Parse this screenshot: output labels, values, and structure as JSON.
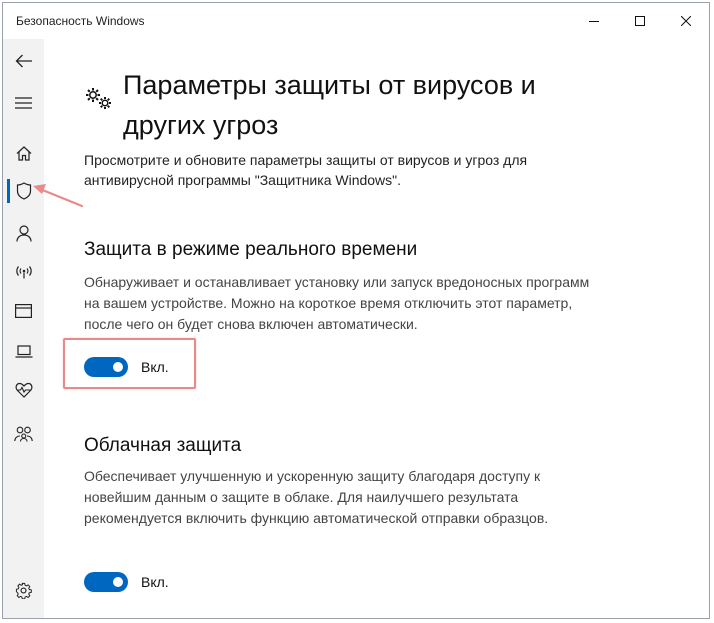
{
  "window": {
    "title": "Безопасность Windows"
  },
  "colors": {
    "accent": "#0067c0",
    "sidebar_bg": "#f2f2f2",
    "annotation": "#e8898a"
  },
  "sidebar": {
    "items": [
      {
        "icon": "back-arrow-icon"
      },
      {
        "icon": "hamburger-menu-icon"
      },
      {
        "icon": "home-icon"
      },
      {
        "icon": "shield-icon",
        "active": true
      },
      {
        "icon": "person-icon"
      },
      {
        "icon": "wireless-icon"
      },
      {
        "icon": "app-browser-icon"
      },
      {
        "icon": "laptop-icon"
      },
      {
        "icon": "heart-pulse-icon"
      },
      {
        "icon": "family-icon"
      },
      {
        "icon": "gear-icon"
      }
    ]
  },
  "page": {
    "title": "Параметры защиты от вирусов и других угроз",
    "description": "Просмотрите и обновите параметры защиты от вирусов и угроз для антивирусной программы \"Защитника Windows\"."
  },
  "sections": [
    {
      "title": "Защита в режиме реального времени",
      "description": "Обнаруживает и останавливает установку или запуск вредоносных программ на вашем устройстве. Можно на короткое время отключить этот параметр, после чего он будет снова включен автоматически.",
      "toggle_on": true,
      "toggle_label": "Вкл."
    },
    {
      "title": "Облачная защита",
      "description": "Обеспечивает улучшенную и ускоренную защиту благодаря доступу к новейшим данным о защите в облаке. Для наилучшего результата рекомендуется включить функцию автоматической отправки образцов.",
      "toggle_on": true,
      "toggle_label": "Вкл."
    }
  ]
}
